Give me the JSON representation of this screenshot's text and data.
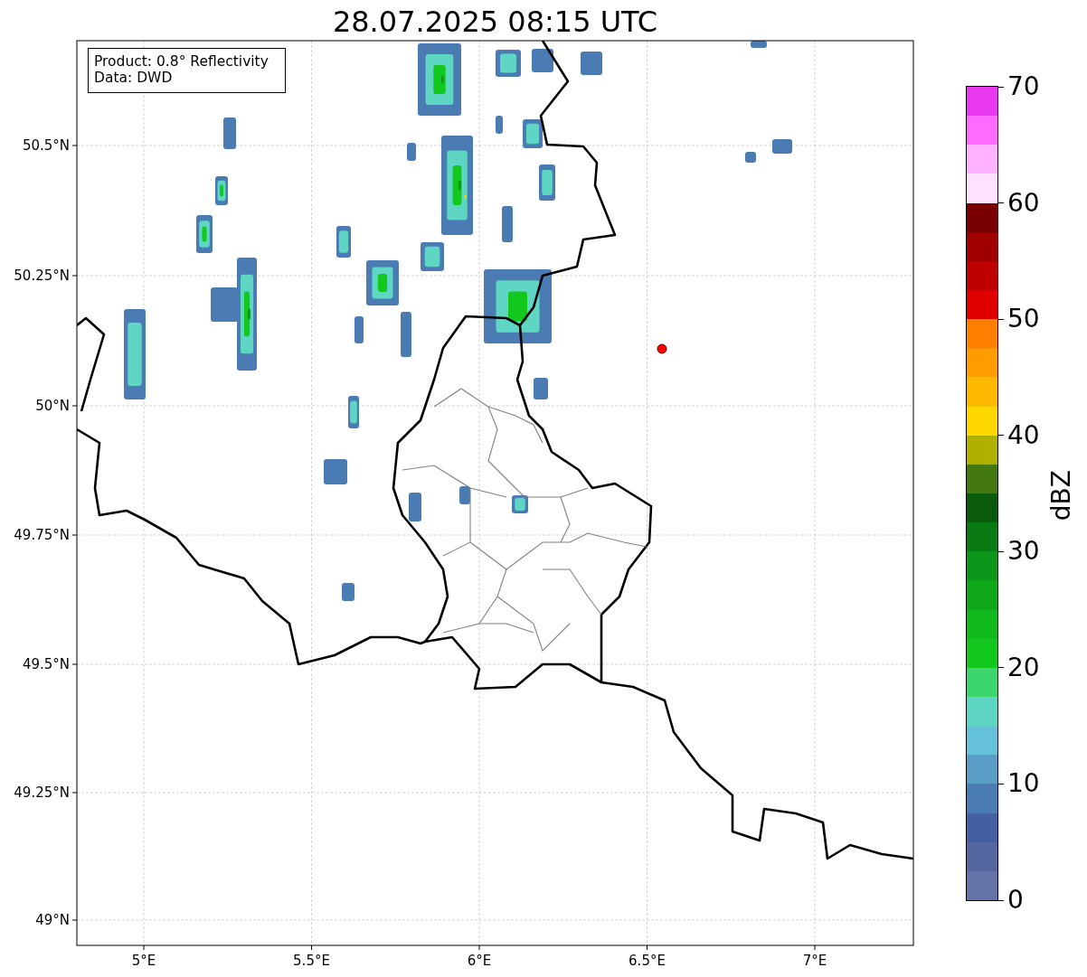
{
  "title": "28.07.2025 08:15 UTC",
  "info_box": {
    "lines": [
      "Product: 0.8° Reflectivity",
      "Data: DWD"
    ]
  },
  "map": {
    "x_ticks": [
      "5°E",
      "5.5°E",
      "6°E",
      "6.5°E",
      "7°E"
    ],
    "y_ticks": [
      "50.5°N",
      "50.25°N",
      "50°N",
      "49.75°N",
      "49.5°N",
      "49.25°N",
      "49°N"
    ]
  },
  "colorbar": {
    "label": "dBZ",
    "ticks": [
      "70",
      "60",
      "50",
      "40",
      "30",
      "20",
      "10",
      "0"
    ],
    "bins": [
      {
        "color": "#6673a8"
      },
      {
        "color": "#5467a0"
      },
      {
        "color": "#4360a3"
      },
      {
        "color": "#4a7bb3"
      },
      {
        "color": "#5a9ec8"
      },
      {
        "color": "#66c2dc"
      },
      {
        "color": "#5fd6c4"
      },
      {
        "color": "#3dd66c"
      },
      {
        "color": "#12c81c"
      },
      {
        "color": "#10b91c"
      },
      {
        "color": "#0ea81a"
      },
      {
        "color": "#0c961a"
      },
      {
        "color": "#0a7a12"
      },
      {
        "color": "#0a5c0c"
      },
      {
        "color": "#457811"
      },
      {
        "color": "#b0b000"
      },
      {
        "color": "#ffd800"
      },
      {
        "color": "#ffb800"
      },
      {
        "color": "#ff9c00"
      },
      {
        "color": "#ff7f00"
      },
      {
        "color": "#e00000"
      },
      {
        "color": "#c00000"
      },
      {
        "color": "#a00000"
      },
      {
        "color": "#780000"
      },
      {
        "color": "#ffe0ff"
      },
      {
        "color": "#ffb2ff"
      },
      {
        "color": "#ff6bff"
      },
      {
        "color": "#e838f0"
      }
    ]
  }
}
